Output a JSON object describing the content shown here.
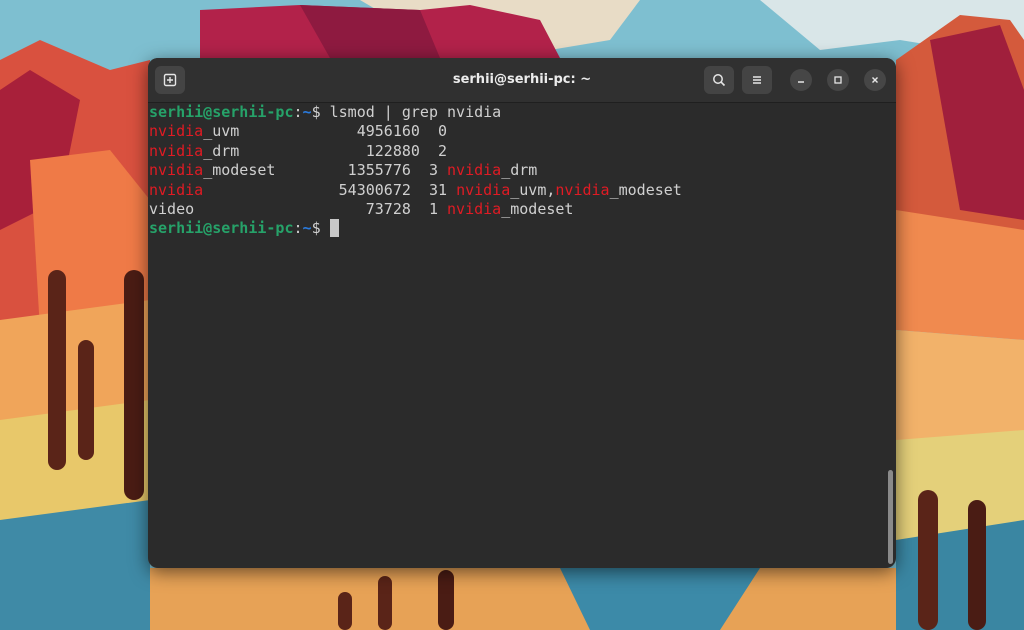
{
  "window": {
    "title": "serhii@serhii-pc: ~"
  },
  "icons": {
    "new_tab": "new-tab-icon",
    "search": "search-icon",
    "menu": "hamburger-menu-icon",
    "minimize": "minimize-icon",
    "maximize": "maximize-icon",
    "close": "close-icon"
  },
  "colors": {
    "prompt_user": "#26a269",
    "prompt_path": "#2a7bde",
    "match_highlight": "#e01b24",
    "terminal_bg": "#2b2b2b",
    "text": "#d0d0d0"
  },
  "terminal": {
    "command": {
      "user": "serhii@serhii-pc",
      "sep": ":",
      "path": "~",
      "symbol": "$ ",
      "text": "lsmod | grep nvidia"
    },
    "output": [
      {
        "hl": "nvidia",
        "rest": "_uvm             4956160  0"
      },
      {
        "hl": "nvidia",
        "rest": "_drm              122880  2"
      },
      {
        "hl": "nvidia",
        "rest": "_modeset        1355776  3 ",
        "hl2": "nvidia",
        "rest2": "_drm"
      },
      {
        "hl": "nvidia",
        "rest": "               54300672  31 ",
        "hl2": "nvidia",
        "rest2": "_uvm,",
        "hl3": "nvidia",
        "rest3": "_modeset"
      },
      {
        "plain": "video                   73728  1 ",
        "hl2": "nvidia",
        "rest2": "_modeset"
      }
    ],
    "prompt": {
      "user": "serhii@serhii-pc",
      "sep": ":",
      "path": "~",
      "symbol": "$ "
    }
  }
}
